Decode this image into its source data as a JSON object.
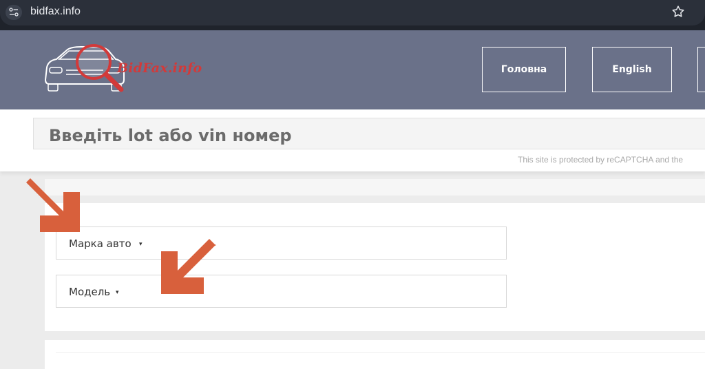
{
  "browser": {
    "url": "bidfax.info",
    "icons": [
      "site-info-icon",
      "bookmark-star-icon"
    ]
  },
  "header": {
    "logo_text": "BidFax.info",
    "nav": {
      "home_label": "Головна",
      "english_label": "English"
    },
    "colors": {
      "background": "#6a7189",
      "logo_accent": "#d23a3a"
    }
  },
  "search": {
    "placeholder": "Введіть lot або vin номер",
    "recaptcha_note": "This site is protected by reCAPTCHA and the"
  },
  "filters": {
    "make_label": "Марка авто",
    "model_label": "Модель",
    "caret": "▾"
  },
  "annotations": {
    "arrow_color": "#d8603c",
    "arrows": [
      "arrow-to-make-select",
      "arrow-to-model-select"
    ]
  }
}
